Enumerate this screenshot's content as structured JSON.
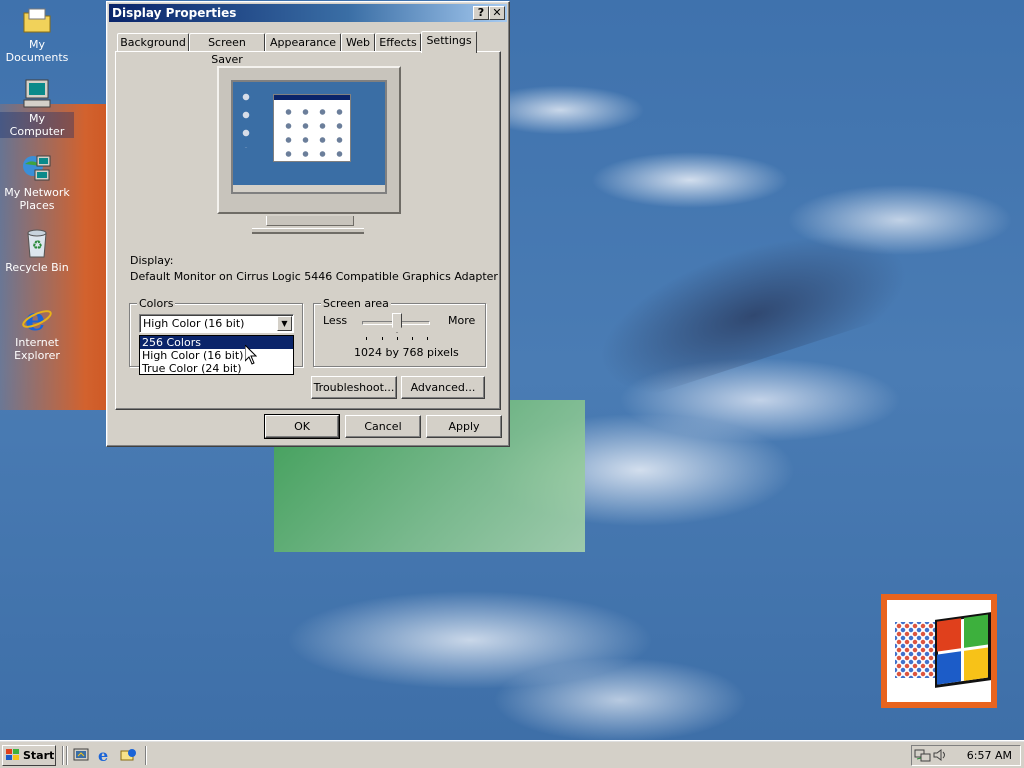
{
  "desktop": {
    "icons": [
      {
        "label": "My Documents"
      },
      {
        "label": "My Computer"
      },
      {
        "label_line1": "My Network",
        "label_line2": "Places"
      },
      {
        "label": "Recycle Bin"
      },
      {
        "label_line1": "Internet",
        "label_line2": "Explorer"
      }
    ]
  },
  "dialog": {
    "title": "Display Properties",
    "help_glyph": "?",
    "close_glyph": "✕",
    "tabs": [
      {
        "label": "Background"
      },
      {
        "label": "Screen Saver"
      },
      {
        "label": "Appearance"
      },
      {
        "label": "Web"
      },
      {
        "label": "Effects"
      },
      {
        "label": "Settings",
        "active": true
      }
    ],
    "display_label": "Display:",
    "display_value": "Default Monitor on Cirrus Logic 5446 Compatible Graphics Adapter",
    "colors": {
      "group_title": "Colors",
      "selected": "High Color (16 bit)",
      "arrow_glyph": "▼",
      "options": [
        "256 Colors",
        "High Color (16 bit)",
        "True Color (24 bit)"
      ],
      "highlighted_index": 0
    },
    "screen_area": {
      "group_title": "Screen area",
      "less": "Less",
      "more": "More",
      "value_text": "1024 by 768 pixels"
    },
    "buttons": {
      "troubleshoot": "Troubleshoot...",
      "advanced": "Advanced...",
      "ok": "OK",
      "cancel": "Cancel",
      "apply": "Apply"
    }
  },
  "taskbar": {
    "start_label": "Start",
    "clock": "6:57 AM"
  },
  "colors": {
    "title_active": "#0a246a",
    "face": "#d4d0c8",
    "desktop": "#3a6ea5",
    "selection": "#0a246a"
  }
}
